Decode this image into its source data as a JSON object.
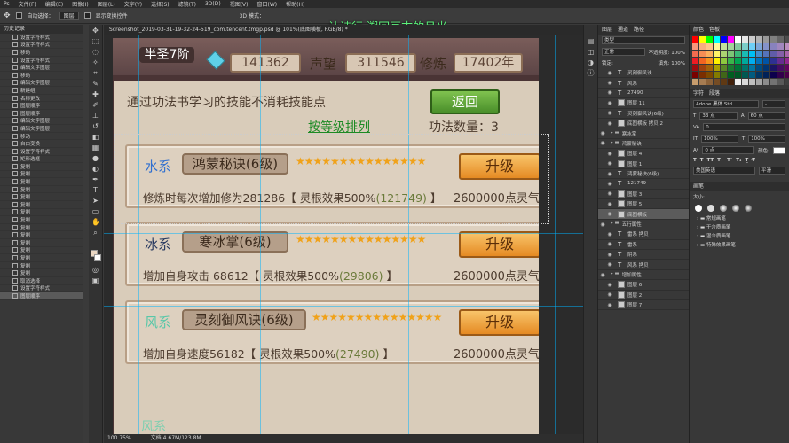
{
  "menubar": {
    "items": [
      "Ps",
      "文件(F)",
      "编辑(E)",
      "图像(I)",
      "图层(L)",
      "文字(Y)",
      "选择(S)",
      "滤镜(T)",
      "3D(D)",
      "视图(V)",
      "窗口(W)",
      "帮助(H)"
    ]
  },
  "options": {
    "autoselect_label": "自动选择：",
    "autoselect_value": "图层",
    "transform_label": "显示变换控件",
    "mode_label": "3D 模式："
  },
  "overlay_text": "让诗行 溯回亘古的月光",
  "history": {
    "title": "历史记录",
    "items": [
      "设置字符样式",
      "设置字符样式",
      "移动",
      "设置字符样式",
      "编辑文字图层",
      "移动",
      "编辑文字图层",
      "新建组",
      "名称更改",
      "图层顺序",
      "图层顺序",
      "编辑文字图层",
      "编辑文字图层",
      "移动",
      "自由变换",
      "设置字符样式",
      "矩形选框",
      "复制",
      "复制",
      "复制",
      "复制",
      "复制",
      "复制",
      "复制",
      "复制",
      "复制",
      "复制",
      "复制",
      "复制",
      "复制",
      "复制",
      "复制",
      "取消选择",
      "设置字符样式",
      "图层顺序"
    ]
  },
  "document": {
    "tab": "Screenshot_2019-03-31-19-32-24-519_com.tencent.tmgp.psd @ 101%(底图横板, RGB/8) *",
    "zoom": "100.75%",
    "doc_size": "文档:4.67M/123.8M"
  },
  "game": {
    "rank": "半圣7阶",
    "gold": "141362",
    "prestige_label": "声望",
    "prestige": "311546",
    "cultivation_label": "修炼",
    "cultivation": "17402年",
    "hint": "通过功法书学习的技能不消耗技能点",
    "back_button": "返回",
    "sort_link": "按等级排列",
    "count": "功法数量：3",
    "stars": "★★★★★★★★★★★★★★★",
    "cards": [
      {
        "element": "水系",
        "element_color": "#2f6fd0",
        "skill": "鸿蒙秘诀(6级)",
        "upgrade": "升级",
        "desc_pre": "修炼时每次增加修为281286【 灵根效果500%",
        "desc_bonus": "(121749)",
        "desc_post": " 】",
        "cost": "2600000点灵气"
      },
      {
        "element": "冰系",
        "element_color": "#24365e",
        "skill": "寒冰掌(6级)",
        "upgrade": "升级",
        "desc_pre": "增加自身攻击 68612【 灵根效果500%",
        "desc_bonus": "(29806)",
        "desc_post": " 】",
        "cost": "2600000点灵气"
      },
      {
        "element": "风系",
        "element_color": "#58c7a8",
        "skill": "灵刻御风诀(6级)",
        "upgrade": "升级",
        "desc_pre": "增加自身速度56182【 灵根效果500%",
        "desc_bonus": "(27490)",
        "desc_post": " 】",
        "cost": "2600000点灵气"
      }
    ],
    "partial_element": "风系"
  },
  "layers": {
    "tabs": [
      "图层",
      "通道",
      "路径"
    ],
    "kind": "类型",
    "blend": "正常",
    "opacity": "不透明度: 100%",
    "fill": "填充: 100%",
    "lock": "锁定:",
    "rows": [
      {
        "name": "灵刻御风诀",
        "type": "text",
        "eye": true
      },
      {
        "name": "风系",
        "type": "text",
        "eye": true
      },
      {
        "name": "27490",
        "type": "text",
        "eye": true
      },
      {
        "name": "图层 11",
        "type": "img",
        "eye": true
      },
      {
        "name": "灵刻御风诀(6级)",
        "type": "text",
        "eye": true
      },
      {
        "name": "底图横板 拷贝 2",
        "type": "img",
        "eye": true
      },
      {
        "name": "寒冰掌",
        "type": "group",
        "eye": true
      },
      {
        "name": "鸿蒙秘诀",
        "type": "group",
        "eye": true
      },
      {
        "name": "图层 4",
        "type": "img",
        "eye": true
      },
      {
        "name": "图层 1",
        "type": "img",
        "eye": true
      },
      {
        "name": "鸿蒙秘诀(6级)",
        "type": "text",
        "eye": true
      },
      {
        "name": "121749",
        "type": "text",
        "eye": true
      },
      {
        "name": "图层 3",
        "type": "img",
        "eye": true
      },
      {
        "name": "图层 5",
        "type": "img",
        "eye": true
      },
      {
        "name": "底图横板",
        "type": "img",
        "eye": true,
        "active": true
      },
      {
        "name": "五行属性",
        "type": "group",
        "eye": true
      },
      {
        "name": "雷系 拷贝",
        "type": "text",
        "eye": true
      },
      {
        "name": "雷系",
        "type": "text",
        "eye": true
      },
      {
        "name": "阴系",
        "type": "text",
        "eye": true
      },
      {
        "name": "风系 拷贝",
        "type": "text",
        "eye": true
      },
      {
        "name": "增加属性",
        "type": "group",
        "eye": true
      },
      {
        "name": "图层 6",
        "type": "img",
        "eye": true
      },
      {
        "name": "图层 2",
        "type": "img",
        "eye": true
      },
      {
        "name": "图层 7",
        "type": "img",
        "eye": true
      }
    ]
  },
  "swatches": {
    "title": "色板",
    "tab2": "颜色",
    "colors": [
      "#ff0000",
      "#ffff00",
      "#00ff00",
      "#00ffff",
      "#0000ff",
      "#ff00ff",
      "#ffffff",
      "#e6e6e6",
      "#cccccc",
      "#b3b3b3",
      "#999999",
      "#808080",
      "#666666",
      "#4d4d4d",
      "#f7977a",
      "#f9ad81",
      "#fdc68a",
      "#fff79a",
      "#c4df9b",
      "#a2d39c",
      "#82ca9d",
      "#7bcdc8",
      "#6ecff6",
      "#7ea7d8",
      "#8493ca",
      "#8882be",
      "#a187be",
      "#bc8dbf",
      "#f26c4f",
      "#f68e55",
      "#fbaf5c",
      "#fff467",
      "#acd372",
      "#7cc576",
      "#3bb878",
      "#1abbb4",
      "#00bff3",
      "#438ccb",
      "#5574b9",
      "#605ca8",
      "#855fa8",
      "#a763a8",
      "#ed1c24",
      "#f26522",
      "#f7941d",
      "#fff200",
      "#8dc73f",
      "#39b54a",
      "#00a651",
      "#00a99d",
      "#00aeef",
      "#0072bc",
      "#0054a6",
      "#2e3192",
      "#662d91",
      "#92278f",
      "#9e0b0f",
      "#a0410d",
      "#a3620a",
      "#aba000",
      "#598527",
      "#1a7b30",
      "#007236",
      "#00746b",
      "#0076a3",
      "#004b80",
      "#003471",
      "#1b1464",
      "#440e62",
      "#630460",
      "#790000",
      "#7b2e00",
      "#7d4900",
      "#827b00",
      "#406618",
      "#005e20",
      "#005826",
      "#005952",
      "#005b7f",
      "#003663",
      "#002157",
      "#0d004c",
      "#32004b",
      "#4b0049",
      "#c69c6d",
      "#a67c52",
      "#8c6239",
      "#754c24",
      "#603913",
      "#42210b",
      "#f0f0f0",
      "#d9d9d9",
      "#bfbfbf",
      "#a6a6a6",
      "#8c8c8c",
      "#737373",
      "#595959",
      "#404040"
    ]
  },
  "character": {
    "title": "字符",
    "tab2": "段落",
    "font": "Adobe 黑体 Std",
    "style": "-",
    "size": "33 点",
    "leading": "60 点",
    "tracking": "0",
    "scale_v": "100%",
    "scale_h": "100%",
    "baseline": "0 点",
    "color_label": "颜色:",
    "lang": "美国英语",
    "aa": "平滑"
  },
  "brushes": {
    "title": "画笔",
    "size_label": "大小:",
    "groups": [
      "常规画笔",
      "干介质画笔",
      "湿介质画笔",
      "特殊效果画笔"
    ]
  }
}
